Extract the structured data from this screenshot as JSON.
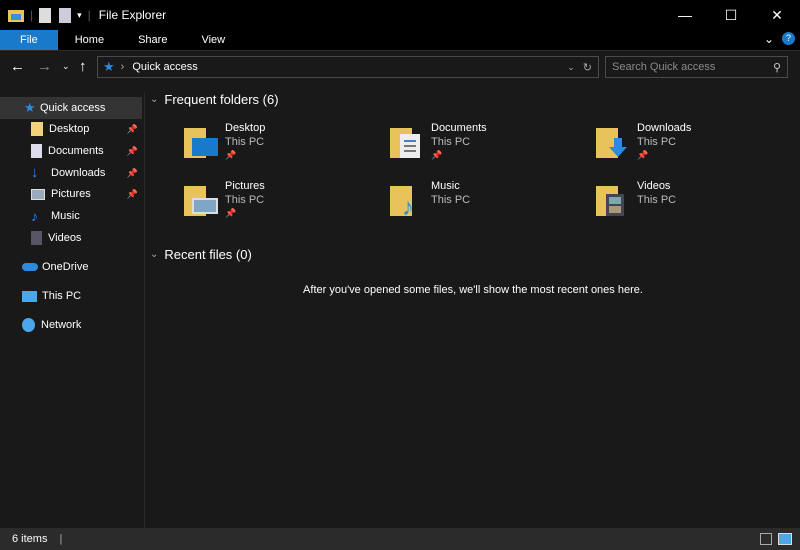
{
  "window": {
    "title": "File Explorer",
    "minimize": "—",
    "maximize": "☐",
    "close": "✕"
  },
  "ribbon": {
    "tabs": [
      "File",
      "Home",
      "Share",
      "View"
    ],
    "collapse": "⌄",
    "help": "?"
  },
  "address": {
    "crumb": "Quick access",
    "search_placeholder": "Search Quick access"
  },
  "sidebar": {
    "items": [
      {
        "label": "Quick access",
        "icon": "star-icon"
      },
      {
        "label": "Desktop",
        "icon": "folder-icon",
        "pinned": true
      },
      {
        "label": "Documents",
        "icon": "documents-icon",
        "pinned": true
      },
      {
        "label": "Downloads",
        "icon": "download-icon",
        "pinned": true
      },
      {
        "label": "Pictures",
        "icon": "pictures-icon",
        "pinned": true
      },
      {
        "label": "Music",
        "icon": "music-icon"
      },
      {
        "label": "Videos",
        "icon": "videos-icon"
      },
      {
        "label": "OneDrive",
        "icon": "cloud-icon"
      },
      {
        "label": "This PC",
        "icon": "computer-icon"
      },
      {
        "label": "Network",
        "icon": "network-icon"
      }
    ]
  },
  "main": {
    "frequent_title": "Frequent folders (6)",
    "folders": [
      {
        "name": "Desktop",
        "location": "This PC",
        "pinned": true
      },
      {
        "name": "Documents",
        "location": "This PC",
        "pinned": true
      },
      {
        "name": "Downloads",
        "location": "This PC",
        "pinned": true
      },
      {
        "name": "Pictures",
        "location": "This PC",
        "pinned": true
      },
      {
        "name": "Music",
        "location": "This PC",
        "pinned": false
      },
      {
        "name": "Videos",
        "location": "This PC",
        "pinned": false
      }
    ],
    "recent_title": "Recent files (0)",
    "recent_empty": "After you've opened some files, we'll show the most recent ones here."
  },
  "status": {
    "items": "6 items"
  },
  "colors": {
    "accent": "#1979ca",
    "folder": "#e8c35a"
  }
}
